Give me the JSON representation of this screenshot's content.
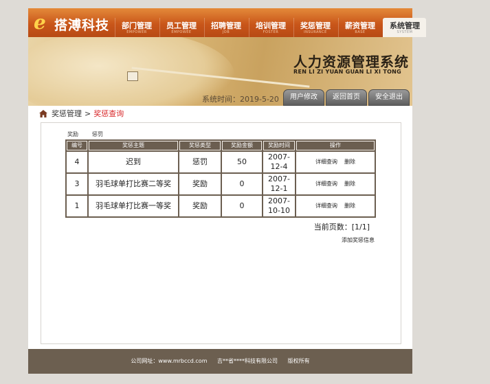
{
  "brand": {
    "logo_letter": "e",
    "name": "搭溥科技"
  },
  "nav": [
    {
      "cn": "部门管理",
      "en": "EMPOWER"
    },
    {
      "cn": "员工管理",
      "en": "EMPOWEE"
    },
    {
      "cn": "招聘管理",
      "en": "JOB"
    },
    {
      "cn": "培训管理",
      "en": "FOSTER"
    },
    {
      "cn": "奖惩管理",
      "en": "INSURANCE"
    },
    {
      "cn": "薪资管理",
      "en": "BASE"
    },
    {
      "cn": "系统管理",
      "en": "SYSTEM"
    }
  ],
  "banner": {
    "title": "人力资源管理系统",
    "subtitle": "REN LI ZI YUAN GUAN LI XI TONG",
    "time": "系统时间：2019-5-20"
  },
  "top_buttons": {
    "user_modify": "用户修改",
    "back_home": "返回首页",
    "logout": "安全退出"
  },
  "breadcrumb": {
    "parent": "奖惩管理",
    "sep": ">",
    "current": "奖惩查询"
  },
  "tabs": {
    "reward": "奖励",
    "punish": "惩罚"
  },
  "table": {
    "headers": [
      "编号",
      "奖惩主题",
      "奖惩类型",
      "奖励金额",
      "奖励时间",
      "操作"
    ],
    "rows": [
      {
        "id": "4",
        "topic": "迟到",
        "type": "惩罚",
        "amount": "50",
        "date": "2007-12-4"
      },
      {
        "id": "3",
        "topic": "羽毛球单打比赛二等奖",
        "type": "奖励",
        "amount": "0",
        "date": "2007-12-1"
      },
      {
        "id": "1",
        "topic": "羽毛球单打比赛一等奖",
        "type": "奖励",
        "amount": "0",
        "date": "2007-10-10"
      }
    ],
    "op_detail": "详细查询",
    "op_delete": "删除"
  },
  "pager": "当前页数：[1/1]",
  "add_link": "添加奖惩信息",
  "footer": {
    "site": "公司网址：www.mrbccd.com",
    "company": "吉**省****科技有限公司",
    "rights": "版权所有"
  },
  "colors": {
    "header_orange": "#c9561a",
    "table_brown": "#6b5e50",
    "breadcrumb_red": "#d8282a"
  }
}
